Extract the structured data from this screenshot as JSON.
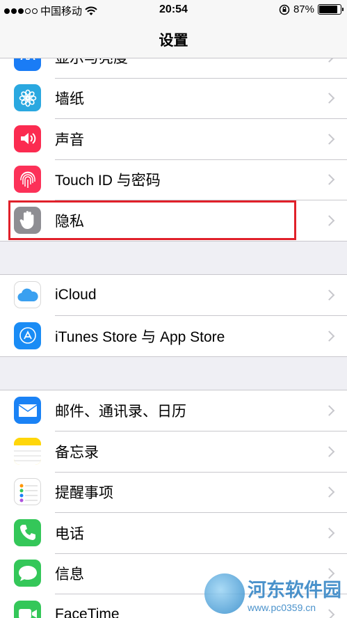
{
  "status_bar": {
    "carrier": "中国移动",
    "time": "20:54",
    "battery": "87%",
    "battery_level": 0.87,
    "icons": [
      "signal-dots",
      "wifi-icon",
      "rotation-lock-icon",
      "battery-icon"
    ]
  },
  "nav": {
    "title": "设置"
  },
  "groups": [
    {
      "rows": [
        {
          "label": "显示与亮度",
          "icon": "display-brightness-icon",
          "color": "#1a7cf5"
        },
        {
          "label": "墙纸",
          "icon": "wallpaper-icon",
          "color": "#2aa8e0"
        },
        {
          "label": "声音",
          "icon": "sound-icon",
          "color": "#fb2b50"
        },
        {
          "label": "Touch ID 与密码",
          "icon": "fingerprint-icon",
          "color": "#fc3158"
        },
        {
          "label": "隐私",
          "icon": "privacy-hand-icon",
          "color": "#8e8e93"
        }
      ]
    },
    {
      "rows": [
        {
          "label": "iCloud",
          "icon": "icloud-icon",
          "color": "#ffffff"
        },
        {
          "label": "iTunes Store 与 App Store",
          "icon": "app-store-icon",
          "color": "#1a8cf5"
        }
      ]
    },
    {
      "rows": [
        {
          "label": "邮件、通讯录、日历",
          "icon": "mail-icon",
          "color": "#1a82f5"
        },
        {
          "label": "备忘录",
          "icon": "notes-icon",
          "color": "#ffd60a"
        },
        {
          "label": "提醒事项",
          "icon": "reminders-icon",
          "color": "#ffffff"
        },
        {
          "label": "电话",
          "icon": "phone-icon",
          "color": "#34c759"
        },
        {
          "label": "信息",
          "icon": "messages-icon",
          "color": "#34c759"
        },
        {
          "label": "FaceTime",
          "icon": "facetime-icon",
          "color": "#34c759"
        }
      ]
    }
  ],
  "highlight": {
    "target": "隐私",
    "color": "#e0202a"
  },
  "watermark": {
    "title": "河东软件园",
    "url": "www.pc0359.cn"
  }
}
